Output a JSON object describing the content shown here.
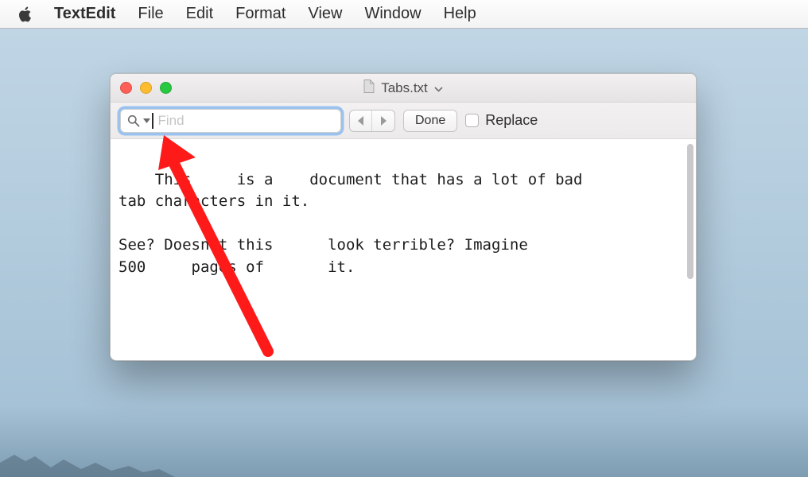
{
  "menubar": {
    "app": "TextEdit",
    "items": [
      "File",
      "Edit",
      "Format",
      "View",
      "Window",
      "Help"
    ]
  },
  "window": {
    "title": "Tabs.txt"
  },
  "findbar": {
    "placeholder": "Find",
    "done": "Done",
    "replace_label": "Replace"
  },
  "editor": {
    "text": "This     is a    document that has a lot of bad\ntab characters in it.\n\nSee? Doesn't this      look terrible? Imagine\n500     pages of       it."
  }
}
